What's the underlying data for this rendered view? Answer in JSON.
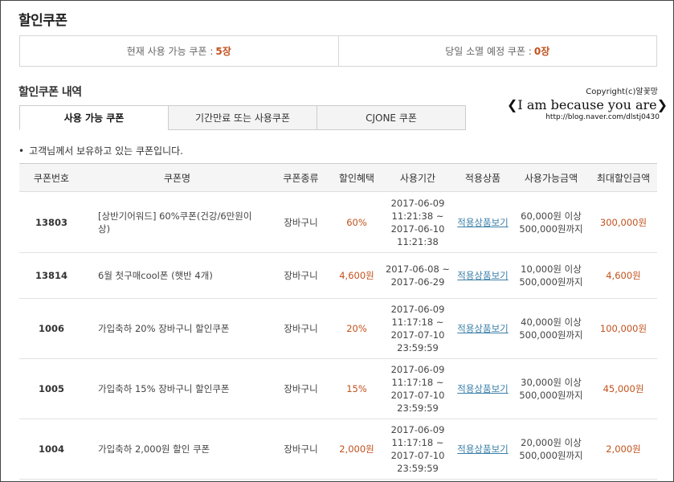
{
  "page": {
    "title": "할인쿠폰"
  },
  "summary": {
    "available_label": "현재 사용 가능 쿠폰 :",
    "available_count": "5장",
    "expiring_label": "당일 소멸 예정 쿠폰 :",
    "expiring_count": "0장"
  },
  "section": {
    "title": "할인쿠폰 내역"
  },
  "tabs": [
    {
      "label": "사용 가능 쿠폰",
      "active": true
    },
    {
      "label": "기간만료 또는 사용쿠폰",
      "active": false
    },
    {
      "label": "CJONE 쿠폰",
      "active": false
    }
  ],
  "watermark": {
    "copyright": "Copyright(c)알꽃망",
    "text": "❮I am because you are❯",
    "url": "http://blog.naver.com/dlstj0430"
  },
  "note": {
    "bullet": "•",
    "text": "고객님께서 보유하고 있는 쿠폰입니다."
  },
  "table": {
    "headers": [
      "쿠폰번호",
      "쿠폰명",
      "쿠폰종류",
      "할인혜택",
      "사용기간",
      "적용상품",
      "사용가능금액",
      "최대할인금액"
    ],
    "rows": [
      {
        "no": "13803",
        "name": "[상반기어워드] 60%쿠폰(건강/6만원이상)",
        "type": "장바구니",
        "benefit": "60%",
        "period_lines": [
          "2017-06-09",
          "11:21:38 ~",
          "2017-06-10",
          "11:21:38"
        ],
        "product_link": "적용상품보기",
        "usable_lines": [
          "60,000원 이상",
          "500,000원까지"
        ],
        "max_discount": "300,000원"
      },
      {
        "no": "13814",
        "name": "6월 첫구매cool폰 (햇반 4개)",
        "type": "장바구니",
        "benefit": "4,600원",
        "period_lines": [
          "2017-06-08 ~",
          "2017-06-29"
        ],
        "product_link": "적용상품보기",
        "usable_lines": [
          "10,000원 이상",
          "500,000원까지"
        ],
        "max_discount": "4,600원"
      },
      {
        "no": "1006",
        "name": "가입축하 20% 장바구니 할인쿠폰",
        "type": "장바구니",
        "benefit": "20%",
        "period_lines": [
          "2017-06-09",
          "11:17:18 ~",
          "2017-07-10",
          "23:59:59"
        ],
        "product_link": "적용상품보기",
        "usable_lines": [
          "40,000원 이상",
          "500,000원까지"
        ],
        "max_discount": "100,000원"
      },
      {
        "no": "1005",
        "name": "가입축하 15% 장바구니 할인쿠폰",
        "type": "장바구니",
        "benefit": "15%",
        "period_lines": [
          "2017-06-09",
          "11:17:18 ~",
          "2017-07-10",
          "23:59:59"
        ],
        "product_link": "적용상품보기",
        "usable_lines": [
          "30,000원 이상",
          "500,000원까지"
        ],
        "max_discount": "45,000원"
      },
      {
        "no": "1004",
        "name": "가입축하 2,000원 할인 쿠폰",
        "type": "장바구니",
        "benefit": "2,000원",
        "period_lines": [
          "2017-06-09",
          "11:17:18 ~",
          "2017-07-10",
          "23:59:59"
        ],
        "product_link": "적용상품보기",
        "usable_lines": [
          "20,000원 이상",
          "500,000원까지"
        ],
        "max_discount": "2,000원"
      }
    ]
  },
  "colors": {
    "accent": "#c0521d",
    "link": "#3a7fa8",
    "header_bg": "#f5f5f5",
    "tab_bg": "#f4f4f4"
  }
}
